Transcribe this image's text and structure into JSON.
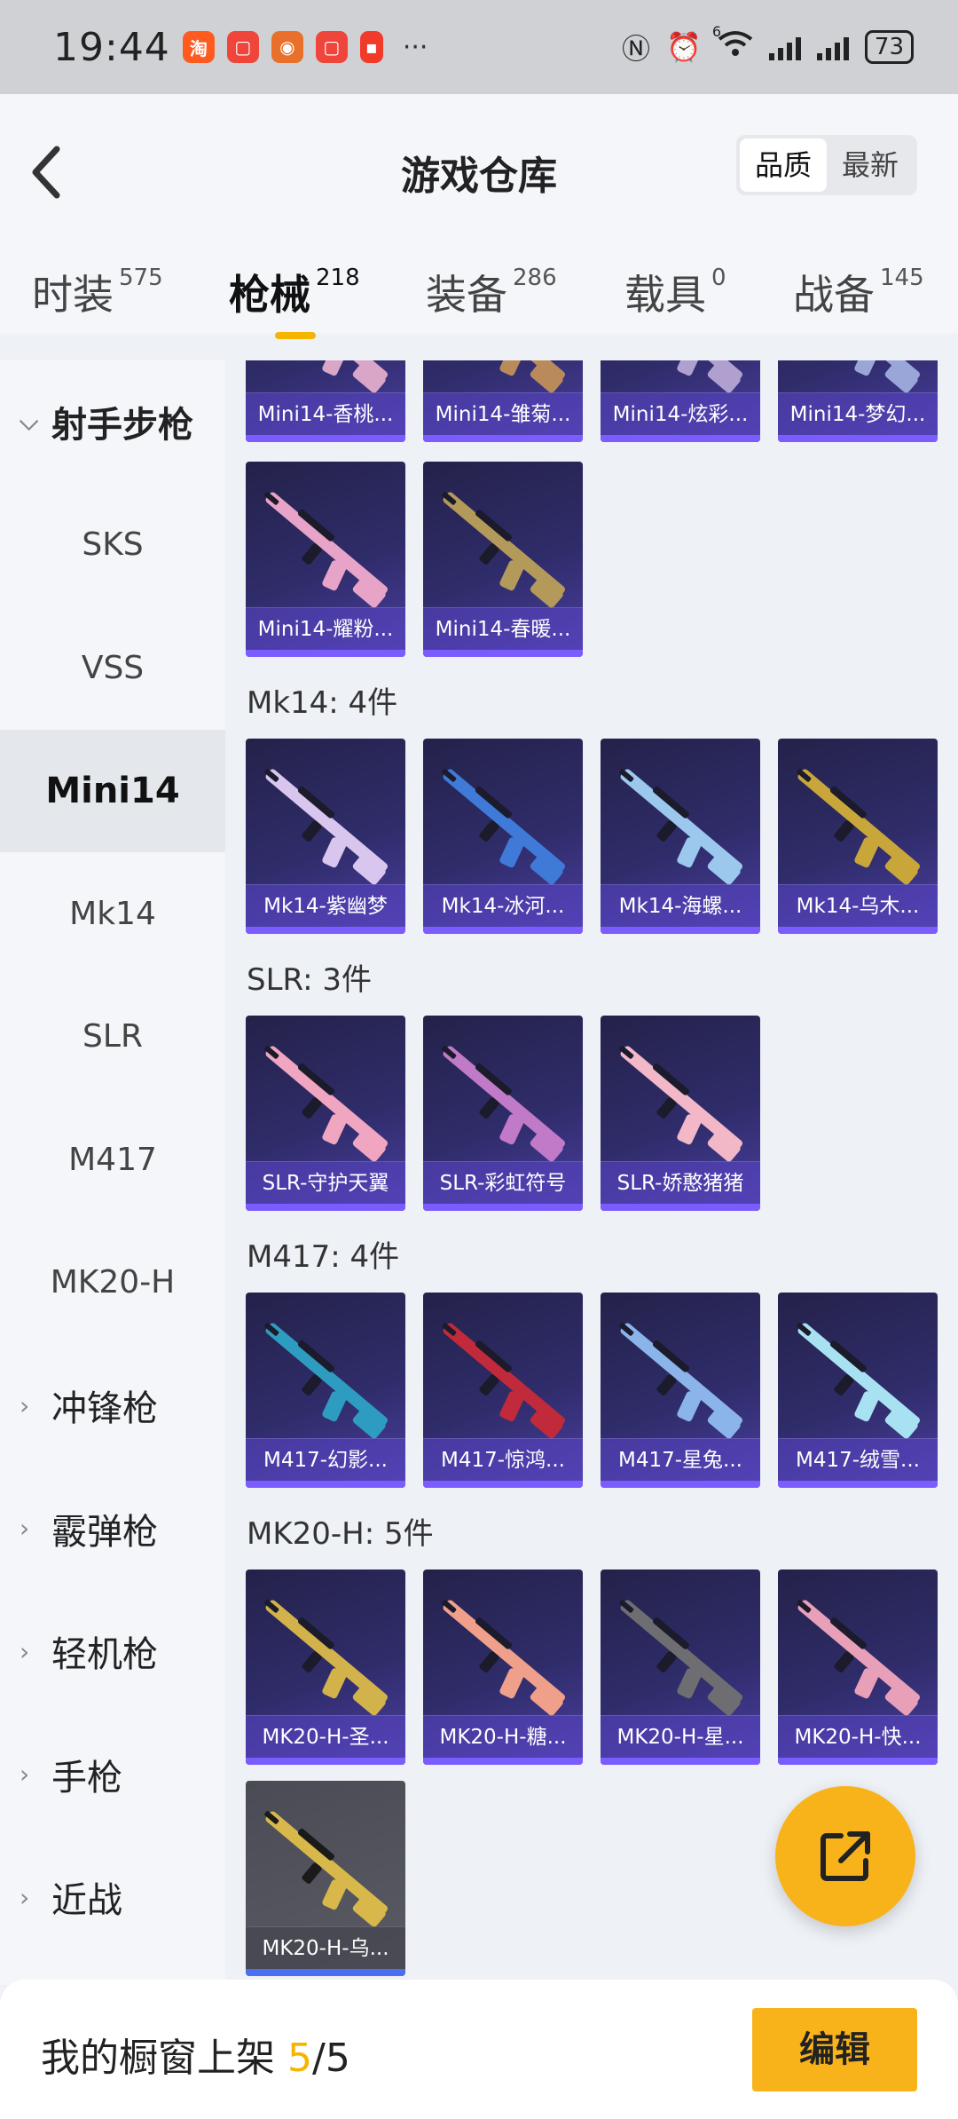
{
  "status_bar": {
    "time": "19:44",
    "battery": "73",
    "wifi_badge": "6"
  },
  "header": {
    "title": "游戏仓库",
    "sort": [
      "品质",
      "最新"
    ],
    "sort_active": 0
  },
  "tabs": [
    {
      "label": "时装",
      "count": "575"
    },
    {
      "label": "枪械",
      "count": "218"
    },
    {
      "label": "装备",
      "count": "286"
    },
    {
      "label": "载具",
      "count": "0"
    },
    {
      "label": "战备",
      "count": "145"
    }
  ],
  "active_tab": 1,
  "sidebar": {
    "items": [
      {
        "label": "射手步枪",
        "type": "category",
        "chevron": "down"
      },
      {
        "label": "SKS",
        "type": "sub"
      },
      {
        "label": "VSS",
        "type": "sub"
      },
      {
        "label": "Mini14",
        "type": "sub",
        "active": true
      },
      {
        "label": "Mk14",
        "type": "sub"
      },
      {
        "label": "SLR",
        "type": "sub"
      },
      {
        "label": "M417",
        "type": "sub"
      },
      {
        "label": "MK20-H",
        "type": "sub"
      },
      {
        "label": "冲锋枪",
        "type": "category",
        "chevron": "right"
      },
      {
        "label": "霰弹枪",
        "type": "category",
        "chevron": "right"
      },
      {
        "label": "轻机枪",
        "type": "category",
        "chevron": "right"
      },
      {
        "label": "手枪",
        "type": "category",
        "chevron": "right"
      },
      {
        "label": "近战",
        "type": "category",
        "chevron": "right"
      }
    ]
  },
  "sections": [
    {
      "title": "",
      "items": [
        "Mini14-香桃...",
        "Mini14-雏菊...",
        "Mini14-炫彩...",
        "Mini14-梦幻...",
        "Mini14-耀粉...",
        "Mini14-春暖..."
      ]
    },
    {
      "title": "Mk14: 4件",
      "items": [
        "Mk14-紫幽梦",
        "Mk14-冰河...",
        "Mk14-海螺...",
        "Mk14-乌木..."
      ]
    },
    {
      "title": "SLR: 3件",
      "items": [
        "SLR-守护天翼",
        "SLR-彩虹符号",
        "SLR-娇憨猪猪"
      ]
    },
    {
      "title": "M417: 4件",
      "items": [
        "M417-幻影...",
        "M417-惊鸿...",
        "M417-星兔...",
        "M417-绒雪..."
      ]
    },
    {
      "title": "MK20-H: 5件",
      "items": [
        "MK20-H-圣...",
        "MK20-H-糖...",
        "MK20-H-星...",
        "MK20-H-快...",
        "MK20-H-乌..."
      ]
    }
  ],
  "gun_colors": [
    [
      "#d9a6c8",
      "#b98a5a",
      "#b0a0d0",
      "#9aa6d8",
      "#e8a4c8",
      "#b49a5a"
    ],
    [
      "#d8c6ee",
      "#3f7ad8",
      "#9cc8ee",
      "#c9a63a"
    ],
    [
      "#f0a6c0",
      "#c07ac8",
      "#f2b8c8"
    ],
    [
      "#2e9cc0",
      "#c02a3a",
      "#8ab4ea",
      "#a8e2f2"
    ],
    [
      "#d2b24a",
      "#f0a08a",
      "#6e6e72",
      "#e8a0b8",
      "#d8b84a"
    ]
  ],
  "bottom_bar": {
    "label": "我的橱窗上架",
    "current": "5",
    "separator": "/",
    "total": "5",
    "edit": "编辑"
  }
}
